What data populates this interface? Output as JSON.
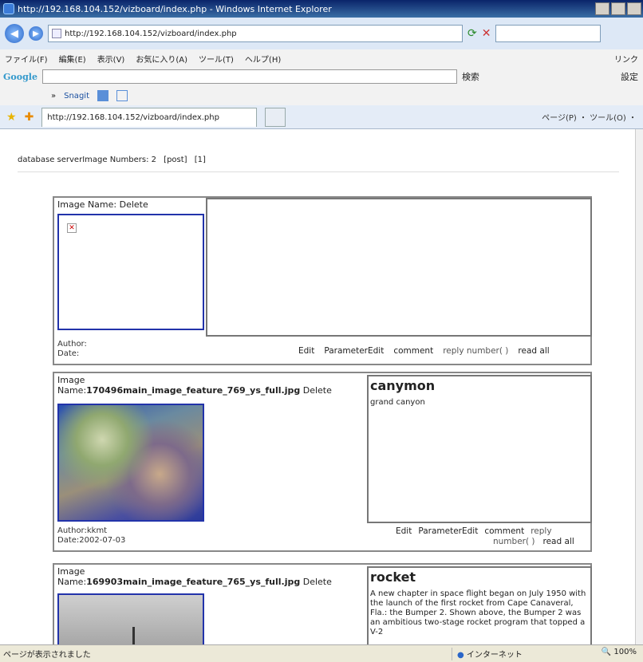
{
  "window": {
    "title": "http://192.168.104.152/vizboard/index.php - Windows Internet Explorer"
  },
  "address": {
    "url": "http://192.168.104.152/vizboard/index.php"
  },
  "menu": [
    "ファイル(F)",
    "編集(E)",
    "表示(V)",
    "お気に入り(A)",
    "ツール(T)",
    "ヘルプ(H)"
  ],
  "menu_right": "リンク",
  "googlebar": {
    "logo": "Google",
    "search_btn": "検索",
    "settings": "設定"
  },
  "linkbar": {
    "items": [
      "»",
      "Snagit",
      "",
      ""
    ]
  },
  "tab": {
    "title": "http://192.168.104.152/vizboard/index.php",
    "tools": "ページ(P) ・ ツール(O) ・"
  },
  "header": {
    "text": "database serverImage Numbers: 2",
    "post": "[post]",
    "page": "[1]"
  },
  "cards": [
    {
      "image_label": "Image Name:",
      "image_name": "",
      "delete": "Delete",
      "title": "",
      "text": "",
      "author": "Author:",
      "date": "Date:",
      "edit": "Edit",
      "param": "ParameterEdit",
      "comment": "comment",
      "reply": "reply number( )",
      "readall": "read all"
    },
    {
      "image_label": "Image",
      "image_name_label": "Name:",
      "image_name": "170496main_image_feature_769_ys_full.jpg",
      "delete": "Delete",
      "title": "canymon",
      "text": "grand canyon",
      "author": "Author:kkmt",
      "date": "Date:2002-07-03",
      "edit": "Edit",
      "param": "ParameterEdit",
      "comment": "comment",
      "reply": "reply",
      "reply2": "number( )",
      "readall": "read all"
    },
    {
      "image_label": "Image",
      "image_name_label": "Name:",
      "image_name": "169903main_image_feature_765_ys_full.jpg",
      "delete": "Delete",
      "title": "rocket",
      "text": "A new chapter in space flight began on July 1950 with the launch of the first rocket from Cape Canaveral, Fla.: the Bumper 2. Shown above, the Bumper 2 was an ambitious two-stage rocket program that topped a V-2"
    }
  ],
  "status": {
    "left": "ページが表示されました",
    "zone": "インターネット",
    "zoom": "100%"
  }
}
